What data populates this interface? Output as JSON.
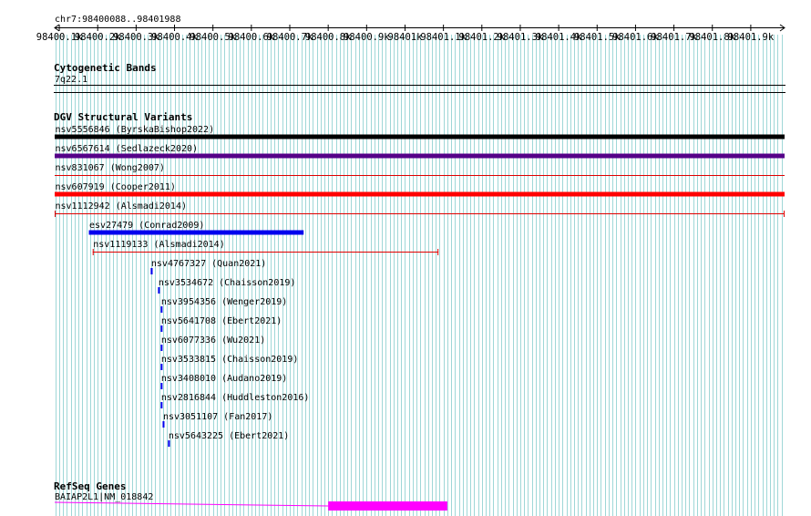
{
  "region": {
    "label": "chr7:98400088..98401988",
    "start": 98400088,
    "end": 98401988
  },
  "ruler": {
    "ticks": [
      {
        "pos": 98400100,
        "label": "98400.1k"
      },
      {
        "pos": 98400200,
        "label": "98400.2k"
      },
      {
        "pos": 98400300,
        "label": "98400.3k"
      },
      {
        "pos": 98400400,
        "label": "98400.4k"
      },
      {
        "pos": 98400500,
        "label": "98400.5k"
      },
      {
        "pos": 98400600,
        "label": "98400.6k"
      },
      {
        "pos": 98400700,
        "label": "98400.7k"
      },
      {
        "pos": 98400800,
        "label": "98400.8k"
      },
      {
        "pos": 98400900,
        "label": "98400.9k"
      },
      {
        "pos": 98401000,
        "label": "98401k"
      },
      {
        "pos": 98401100,
        "label": "98401.1k"
      },
      {
        "pos": 98401200,
        "label": "98401.2k"
      },
      {
        "pos": 98401300,
        "label": "98401.3k"
      },
      {
        "pos": 98401400,
        "label": "98401.4k"
      },
      {
        "pos": 98401500,
        "label": "98401.5k"
      },
      {
        "pos": 98401600,
        "label": "98401.6k"
      },
      {
        "pos": 98401700,
        "label": "98401.7k"
      },
      {
        "pos": 98401800,
        "label": "98401.8k"
      },
      {
        "pos": 98401900,
        "label": "98401.9k"
      }
    ]
  },
  "tracks": {
    "cytobands": {
      "title": "Cytogenetic Bands",
      "band_label": "7q22.1"
    },
    "dgv": {
      "title": "DGV Structural Variants",
      "features": [
        {
          "id": "sv1",
          "label": "nsv5556846 (ByrskaBishop2022)",
          "start": 98400088,
          "end": 98401988,
          "style": "thick",
          "color": "#000000"
        },
        {
          "id": "sv2",
          "label": "nsv6567614 (Sedlazeck2020)",
          "start": 98400088,
          "end": 98401988,
          "style": "thick",
          "color": "#550088"
        },
        {
          "id": "sv3",
          "label": "nsv831067 (Wong2007)",
          "start": 98400088,
          "end": 98401988,
          "style": "line",
          "color": "#e00000"
        },
        {
          "id": "sv4",
          "label": "nsv607919 (Cooper2011)",
          "start": 98400088,
          "end": 98401988,
          "style": "thick",
          "color": "#ff0000"
        },
        {
          "id": "sv5",
          "label": "nsv1112942 (Alsmadi2014)",
          "start": 98400088,
          "end": 98401988,
          "style": "range",
          "color": "#e00000"
        },
        {
          "id": "sv6",
          "label": "esv27479 (Conrad2009)",
          "start": 98400177,
          "end": 98400736,
          "style": "thick",
          "color": "#0000ee"
        },
        {
          "id": "sv7",
          "label": "nsv1119133 (Alsmadi2014)",
          "start": 98400187,
          "end": 98401087,
          "style": "range",
          "color": "#e00000"
        },
        {
          "id": "sv8",
          "label": "nsv4767327 (Quan2021)",
          "start": 98400338,
          "end": 98400343,
          "style": "tick",
          "color": "#0000ee"
        },
        {
          "id": "sv9",
          "label": "nsv3534672 (Chaisson2019)",
          "start": 98400357,
          "end": 98400361,
          "style": "tick",
          "color": "#0000ee"
        },
        {
          "id": "sv10",
          "label": "nsv3954356 (Wenger2019)",
          "start": 98400364,
          "end": 98400368,
          "style": "tick",
          "color": "#0000ee"
        },
        {
          "id": "sv11",
          "label": "nsv5641708 (Ebert2021)",
          "start": 98400364,
          "end": 98400368,
          "style": "tick",
          "color": "#0000ee"
        },
        {
          "id": "sv12",
          "label": "nsv6077336 (Wu2021)",
          "start": 98400364,
          "end": 98400368,
          "style": "tick",
          "color": "#0000ee"
        },
        {
          "id": "sv13",
          "label": "nsv3533815 (Chaisson2019)",
          "start": 98400364,
          "end": 98400368,
          "style": "tick",
          "color": "#0000ee"
        },
        {
          "id": "sv14",
          "label": "nsv3408010 (Audano2019)",
          "start": 98400364,
          "end": 98400368,
          "style": "tick",
          "color": "#0000ee"
        },
        {
          "id": "sv15",
          "label": "nsv2816844 (Huddleston2016)",
          "start": 98400364,
          "end": 98400368,
          "style": "tick",
          "color": "#0000ee"
        },
        {
          "id": "sv16",
          "label": "nsv3051107 (Fan2017)",
          "start": 98400369,
          "end": 98400373,
          "style": "tick",
          "color": "#0000ee"
        },
        {
          "id": "sv17",
          "label": "nsv5643225 (Ebert2021)",
          "start": 98400383,
          "end": 98400388,
          "style": "tick",
          "color": "#0000ee"
        }
      ]
    },
    "refseq": {
      "title": "RefSeq Genes",
      "gene_label": "BAIAP2L1|NM_018842",
      "color": "#ff00ff",
      "line_start": 98400088,
      "exon_start": 98400800,
      "exon_end": 98401110
    }
  },
  "colors": {
    "grid": "#9fd7d7",
    "rule": "#000000"
  }
}
